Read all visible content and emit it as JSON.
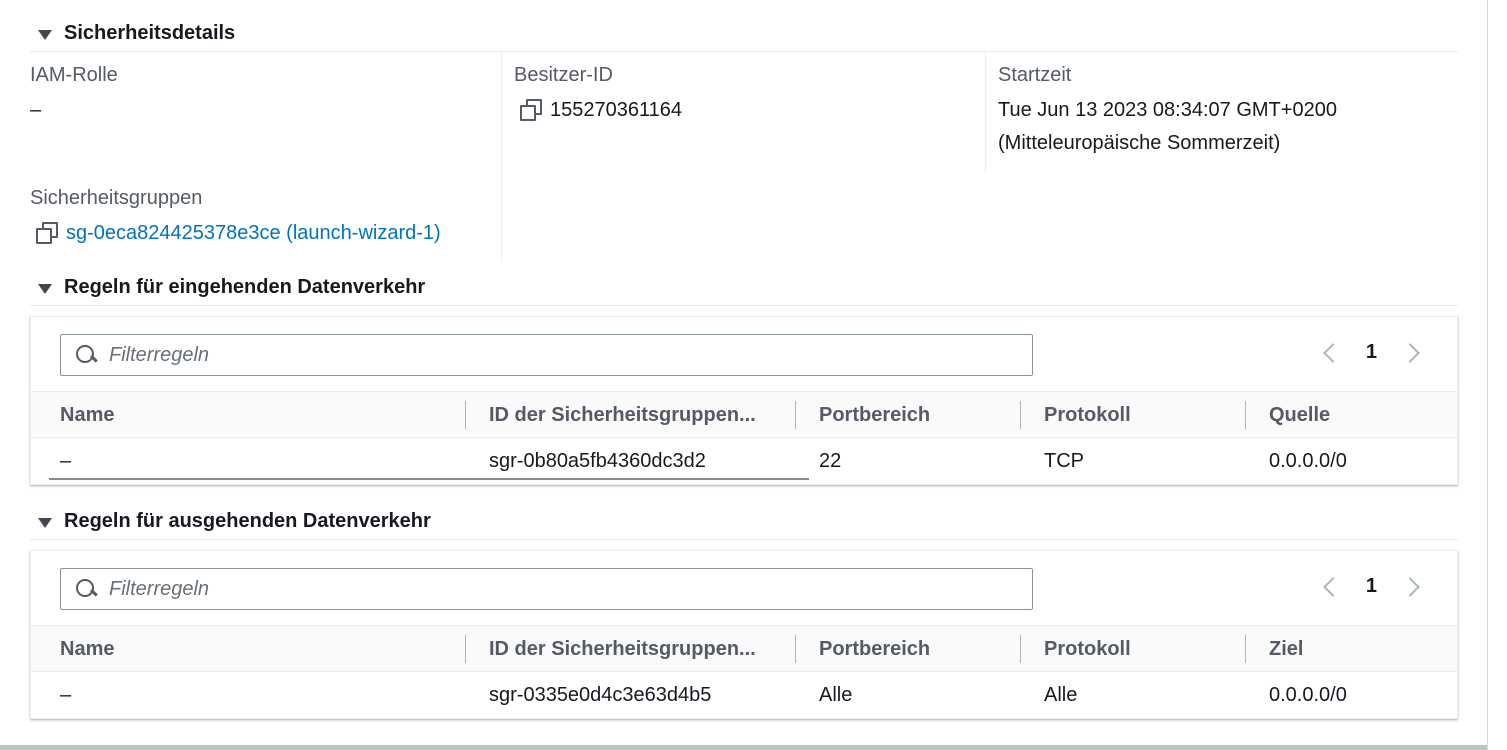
{
  "security": {
    "title": "Sicherheitsdetails",
    "iam_label": "IAM-Rolle",
    "iam_value": "–",
    "owner_label": "Besitzer-ID",
    "owner_value": "155270361164",
    "start_label": "Startzeit",
    "start_value_line1": "Tue Jun 13 2023 08:34:07 GMT+0200",
    "start_value_line2": "(Mitteleuropäische Sommerzeit)",
    "groups_label": "Sicherheitsgruppen",
    "groups_value": "sg-0eca824425378e3ce (launch-wizard-1)"
  },
  "inbound": {
    "title": "Regeln für eingehenden Datenverkehr",
    "filter_placeholder": "Filterregeln",
    "page": "1",
    "columns": [
      "Name",
      "ID der Sicherheitsgruppen...",
      "Portbereich",
      "Protokoll",
      "Quelle"
    ],
    "rows": [
      [
        "–",
        "sgr-0b80a5fb4360dc3d2",
        "22",
        "TCP",
        "0.0.0.0/0"
      ]
    ]
  },
  "outbound": {
    "title": "Regeln für ausgehenden Datenverkehr",
    "filter_placeholder": "Filterregeln",
    "page": "1",
    "columns": [
      "Name",
      "ID der Sicherheitsgruppen...",
      "Portbereich",
      "Protokoll",
      "Ziel"
    ],
    "rows": [
      [
        "–",
        "sgr-0335e0d4c3e63d4b5",
        "Alle",
        "Alle",
        "0.0.0.0/0"
      ]
    ]
  },
  "colors": {
    "link": "#0073bb",
    "text": "#16191f",
    "label": "#545b64"
  },
  "icons": [
    "caret-down-icon",
    "copy-icon",
    "search-icon",
    "chevron-left-icon",
    "chevron-right-icon"
  ]
}
